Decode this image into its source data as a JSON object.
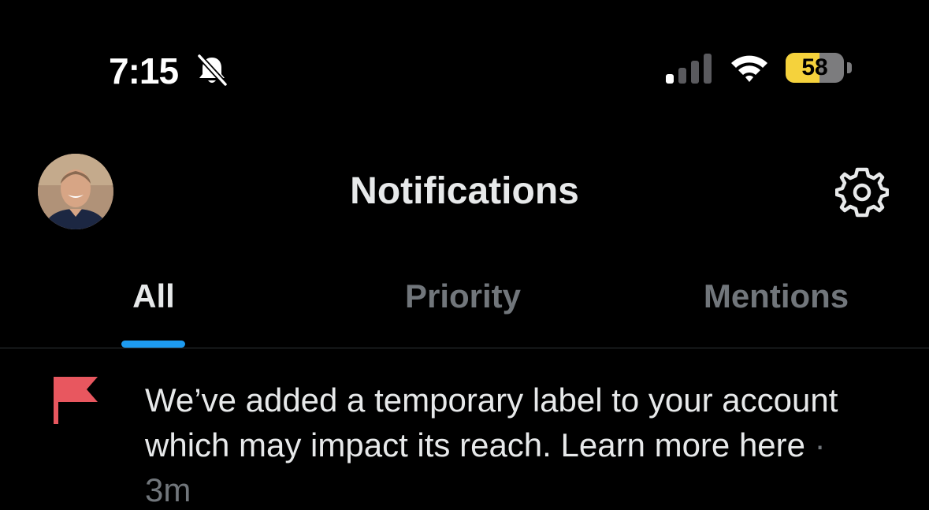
{
  "status_bar": {
    "time": "7:15",
    "battery_level": "58",
    "battery_fraction": 0.58,
    "icons": [
      "bell-slash-icon",
      "cellular-signal-icon",
      "wifi-icon",
      "battery-icon"
    ],
    "battery_color": "#f5d23c"
  },
  "header": {
    "title": "Notifications",
    "avatar_icon": "profile-avatar",
    "settings_icon": "gear-icon"
  },
  "tabs": [
    {
      "label": "All",
      "active": true
    },
    {
      "label": "Priority",
      "active": false
    },
    {
      "label": "Mentions",
      "active": false
    }
  ],
  "accent_color": "#1d9bf0",
  "notifications": [
    {
      "icon": "flag-icon",
      "icon_color": "#e8575f",
      "text": "We’ve added a temporary label to your account which may impact its reach. Learn more here",
      "separator": " · ",
      "time": "3m"
    }
  ]
}
